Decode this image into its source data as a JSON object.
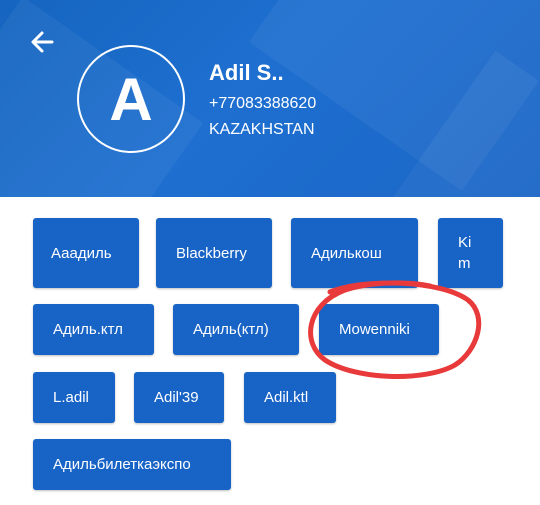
{
  "profile": {
    "initial": "A",
    "name": "Adil S..",
    "phone": "+77083388620",
    "country": "KAZAKHSTAN"
  },
  "header": {
    "back_icon": "arrow-left-icon",
    "background_color": "#1565c0"
  },
  "tags": [
    {
      "label": "Ааадиль"
    },
    {
      "label": "Blackberry"
    },
    {
      "label": "Адилькош"
    },
    {
      "label": "Kim"
    },
    {
      "label": "Адиль.ктл"
    },
    {
      "label": "Адиль(ктл)"
    },
    {
      "label": "Mowenniki"
    },
    {
      "label": "L.adil"
    },
    {
      "label": "Adil'39"
    },
    {
      "label": "Adil.ktl"
    },
    {
      "label": "Адильбилеткаэкспо"
    }
  ],
  "colors": {
    "tag_background": "#1763c6",
    "annotation_circle": "#e83a3a"
  }
}
